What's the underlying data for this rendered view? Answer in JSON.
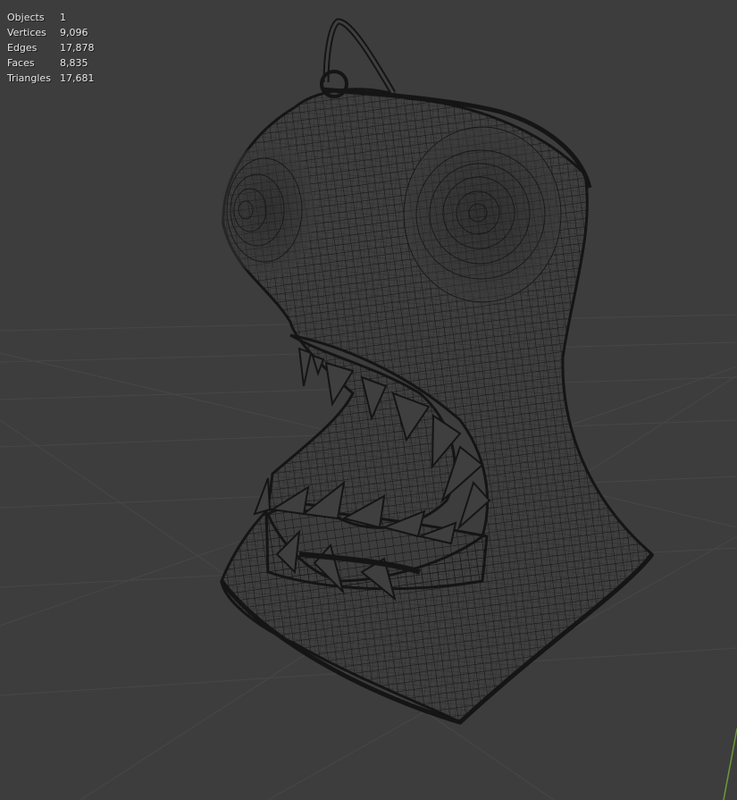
{
  "overlay": {
    "stats": [
      {
        "label": "Objects",
        "value": "1"
      },
      {
        "label": "Vertices",
        "value": "9,096"
      },
      {
        "label": "Edges",
        "value": "17,878"
      },
      {
        "label": "Faces",
        "value": "8,835"
      },
      {
        "label": "Triangles",
        "value": "17,681"
      }
    ]
  },
  "colors": {
    "background": "#3d3d3d",
    "grid_line": "#474747",
    "wireframe": "#151515",
    "mesh_fill": "#3f3f3f",
    "axis_y": "#6b9a3a"
  },
  "viewport": {
    "mode": "wireframe",
    "object_icon": "swimsuit-mesh-icon"
  }
}
